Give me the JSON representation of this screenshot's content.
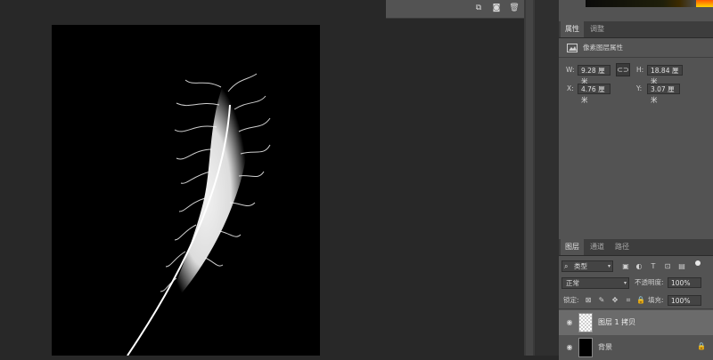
{
  "properties_panel": {
    "tabs": [
      "属性",
      "调整"
    ],
    "layer_type_label": "像素图层属性",
    "w_label": "W:",
    "w_value": "9.28 厘米",
    "h_label": "H:",
    "h_value": "18.84 厘米",
    "x_label": "X:",
    "x_value": "4.76 厘米",
    "y_label": "Y:",
    "y_value": "3.07 厘米"
  },
  "layers_panel": {
    "tabs": [
      "图层",
      "通道",
      "路径"
    ],
    "filter_kind": "类型",
    "blend_mode": "正常",
    "opacity_label": "不透明度:",
    "opacity_value": "100%",
    "lock_label": "锁定:",
    "fill_label": "填充:",
    "fill_value": "100%",
    "layers": [
      {
        "name": "图层 1 拷贝",
        "selected": true
      },
      {
        "name": "背景",
        "selected": false,
        "locked": true
      }
    ]
  },
  "colors": {
    "workspace": "#282828",
    "panel": "#535353",
    "selected_row": "#6b6b6b"
  }
}
